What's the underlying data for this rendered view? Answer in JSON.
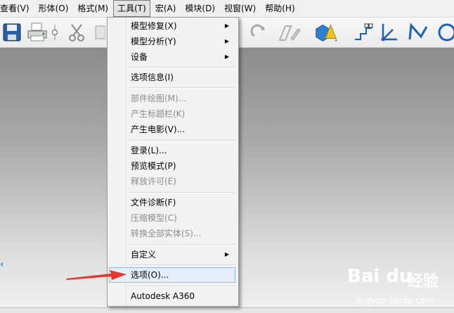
{
  "menubar": {
    "items": [
      "查看(V)",
      "形体(O)",
      "格式(M)",
      "工具(T)",
      "宏(A)",
      "模块(D)",
      "视窗(W)",
      "帮助(H)"
    ]
  },
  "tools_menu": {
    "items": [
      {
        "label": "模型修复(X)",
        "submenu": true,
        "enabled": true
      },
      {
        "label": "模型分析(Y)",
        "submenu": true,
        "enabled": true
      },
      {
        "label": "设备",
        "submenu": true,
        "enabled": true
      },
      {
        "label": "选项信息(I)",
        "submenu": false,
        "enabled": true
      },
      {
        "label": "部件绘图(M)...",
        "submenu": false,
        "enabled": false
      },
      {
        "label": "产生标题栏(K)",
        "submenu": false,
        "enabled": false
      },
      {
        "label": "产生电影(V)...",
        "submenu": false,
        "enabled": true
      },
      {
        "label": "登录(L)...",
        "submenu": false,
        "enabled": true
      },
      {
        "label": "预览模式(P)",
        "submenu": false,
        "enabled": true
      },
      {
        "label": "释放许可(E)",
        "submenu": false,
        "enabled": false
      },
      {
        "label": "文件诊断(F)",
        "submenu": false,
        "enabled": true
      },
      {
        "label": "压缩模型(C)",
        "submenu": false,
        "enabled": false
      },
      {
        "label": "转换全部实体(S)...",
        "submenu": false,
        "enabled": false
      },
      {
        "label": "自定义",
        "submenu": true,
        "enabled": true
      },
      {
        "label": "选项(O)...",
        "submenu": false,
        "enabled": true,
        "highlighted": true
      },
      {
        "label": "Autodesk A360",
        "submenu": false,
        "enabled": true
      }
    ]
  },
  "watermark": {
    "brand": "Bai du",
    "service": "经验",
    "url": "jingyan.baidu.com"
  },
  "icons": [
    "save-icon",
    "printer-icon",
    "scissors-icon",
    "redo-icon",
    "edit-icon",
    "shapes-3d-icon",
    "path-icon",
    "axis-icon",
    "curve-icon",
    "circle-icon"
  ],
  "colors": {
    "annotation_arrow": "#e8352b",
    "highlight": "#e6eefb"
  }
}
